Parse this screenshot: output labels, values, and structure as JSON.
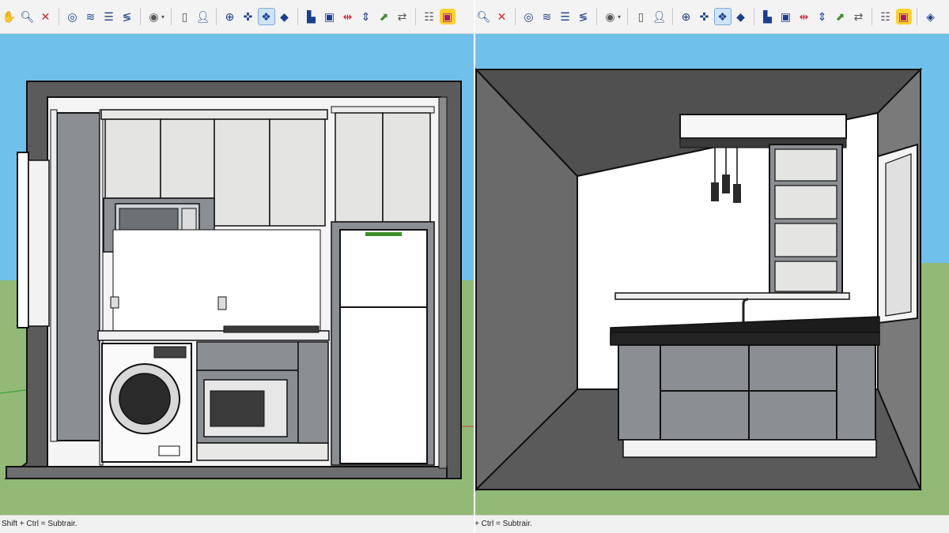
{
  "status": {
    "left_text": "Shift + Ctrl = Subtrair.",
    "right_text": "+ Ctrl = Subtrair."
  },
  "colors": {
    "sky": "#6fc0ea",
    "ground": "#92ba76",
    "wall_dark": "#5b5b5b",
    "wall_mid": "#8c8c8c",
    "cabinet_grey": "#8b8f94",
    "cabinet_light": "#e4e4e2",
    "countertop": "#1c1c1c",
    "white": "#ffffff",
    "accent_blue": "#1b3f8f",
    "accent_red": "#d0262c"
  },
  "icons": [
    "pan-hand-icon",
    "zoom-icon",
    "zoom-extents-icon",
    "section-plane-icon",
    "display-sections-icon",
    "section-cuts-icon",
    "section-fill-icon",
    "outliner-icon",
    "new-document-icon",
    "user-icon",
    "orbit-icon",
    "walk-icon",
    "look-around-icon",
    "position-camera-icon",
    "align-left-icon",
    "select-box-icon",
    "move-red-icon",
    "move-blue-icon",
    "rotate-green-icon",
    "arrows-icon",
    "report-icon",
    "plugin-icon"
  ]
}
